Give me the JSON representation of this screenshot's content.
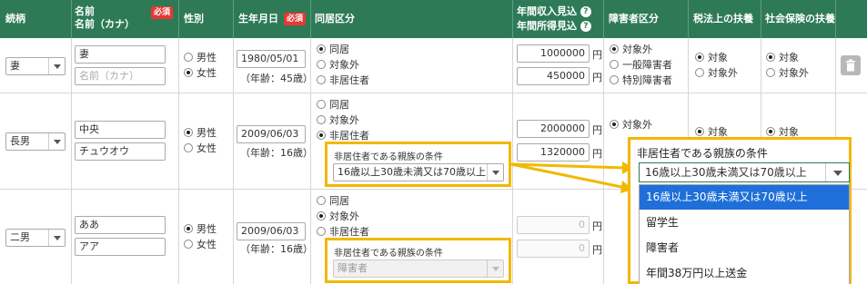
{
  "header": {
    "relation": "続柄",
    "name": "名前",
    "name_kana": "名前（カナ）",
    "required": "必須",
    "gender": "性別",
    "birthdate": "生年月日",
    "cohabitation": "同居区分",
    "income_annual": "年間収入見込",
    "income_earned": "年間所得見込",
    "disability": "障害者区分",
    "tax_dependent": "税法上の扶養",
    "insurance_dependent": "社会保険の扶養",
    "help_icon": "question-icon"
  },
  "options": {
    "male": "男性",
    "female": "女性",
    "cohabit": "同居",
    "not_applicable": "対象外",
    "nonresident": "非居住者",
    "general_disabled": "一般障害者",
    "special_disabled": "特別障害者",
    "applicable": "対象",
    "yen": "円",
    "nonresident_condition_label": "非居住者である親族の条件"
  },
  "rows": [
    {
      "relation": "妻",
      "name": "妻",
      "kana_placeholder": "名前（カナ）",
      "gender": "female",
      "birthdate": "1980/05/01",
      "age": "（年齢：45歳）",
      "cohabitation": "cohabit",
      "annual_income": "1000000",
      "earned_income": "450000",
      "disability": "not_applicable",
      "tax": "applicable",
      "insurance": "applicable"
    },
    {
      "relation": "長男",
      "name": "中央",
      "kana": "チュウオウ",
      "gender": "male",
      "birthdate": "2009/06/03",
      "age": "（年齢：16歳）",
      "cohabitation": "nonresident",
      "condition": "16歳以上30歳未満又は70歳以上",
      "annual_income": "2000000",
      "earned_income": "1320000",
      "disability": "not_applicable",
      "tax": "applicable",
      "insurance": "applicable"
    },
    {
      "relation": "二男",
      "name": "ああ",
      "kana": "アア",
      "gender": "male",
      "birthdate": "2009/06/03",
      "age": "（年齢：16歳）",
      "cohabitation": "not_applicable",
      "condition": "障害者",
      "annual_income": "0",
      "earned_income": "0"
    }
  ],
  "popup": {
    "title": "非居住者である親族の条件",
    "selected": "16歳以上30歳未満又は70歳以上",
    "options": [
      "16歳以上30歳未満又は70歳以上",
      "留学生",
      "障害者",
      "年間38万円以上送金"
    ],
    "active_index": 0
  },
  "colors": {
    "header_bg": "#2e7a57",
    "highlight": "#f2b800",
    "required_badge": "#e53935",
    "active_option": "#1e6fd9"
  }
}
